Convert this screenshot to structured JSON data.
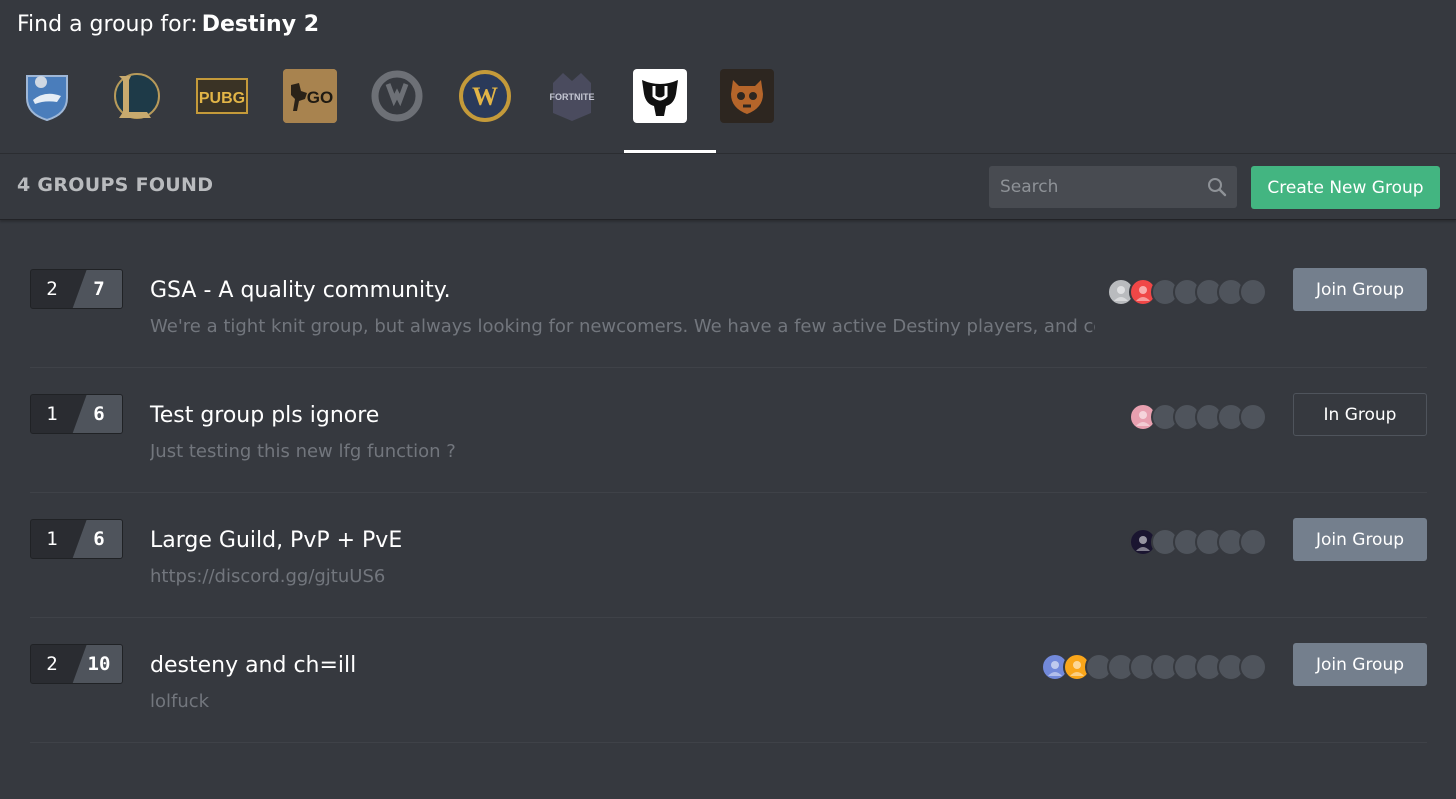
{
  "header": {
    "prefix": "Find a group for:",
    "game": "Destiny 2"
  },
  "games": [
    {
      "id": "rocket-league",
      "icon": "rocket-league-icon",
      "active": false
    },
    {
      "id": "league-of-legends",
      "icon": "league-of-legends-icon",
      "active": false
    },
    {
      "id": "pubg",
      "icon": "pubg-icon",
      "active": false,
      "text": "PUBG"
    },
    {
      "id": "csgo",
      "icon": "csgo-icon",
      "active": false,
      "text": "GO"
    },
    {
      "id": "overwatch",
      "icon": "overwatch-icon",
      "active": false
    },
    {
      "id": "world-of-warcraft",
      "icon": "wow-icon",
      "active": false,
      "text": "W"
    },
    {
      "id": "fortnite",
      "icon": "fortnite-icon",
      "active": false,
      "text": "FORTNITE"
    },
    {
      "id": "destiny-2",
      "icon": "destiny-icon",
      "active": true
    },
    {
      "id": "paladins",
      "icon": "skull-icon",
      "active": false
    }
  ],
  "toolbar": {
    "found_label": "4 GROUPS FOUND",
    "search_placeholder": "Search",
    "create_label": "Create New Group"
  },
  "colors": {
    "accent_green": "#43b581",
    "join_gray": "#747f8d",
    "bg": "#36393f"
  },
  "groups": [
    {
      "current": "2",
      "max": "7",
      "name": "GSA - A quality community.",
      "description": "We're a tight knit group, but always looking for newcomers. We have a few active Destiny players, and co...",
      "button": "Join Group",
      "button_type": "join",
      "avatars": [
        "#b9bbbe",
        "#f04747"
      ],
      "empty_slots": 5
    },
    {
      "current": "1",
      "max": "6",
      "name": "Test group pls ignore",
      "description": "Just testing this new lfg function ?",
      "button": "In Group",
      "button_type": "in",
      "avatars": [
        "#e8a0b0"
      ],
      "empty_slots": 5
    },
    {
      "current": "1",
      "max": "6",
      "name": "Large Guild, PvP + PvE",
      "description": "https://discord.gg/gjtuUS6",
      "button": "Join Group",
      "button_type": "join",
      "avatars": [
        "#1a1530"
      ],
      "empty_slots": 5
    },
    {
      "current": "2",
      "max": "10",
      "name": "desteny and ch=ill",
      "description": "lolfuck",
      "button": "Join Group",
      "button_type": "join",
      "avatars": [
        "#7289da",
        "#faa61a"
      ],
      "empty_slots": 8
    }
  ]
}
